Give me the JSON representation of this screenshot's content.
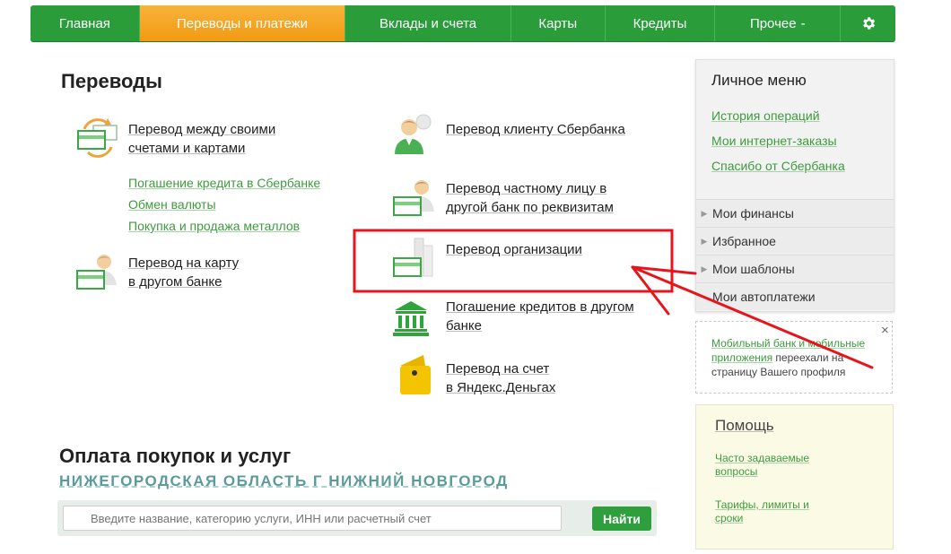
{
  "nav": {
    "items": [
      {
        "label": "Главная"
      },
      {
        "label": "Переводы и платежи"
      },
      {
        "label": "Вклады и счета"
      },
      {
        "label": "Карты"
      },
      {
        "label": "Кредиты"
      },
      {
        "label": "Прочее"
      }
    ],
    "more_caret": "-",
    "settings_icon": "gear-icon",
    "active_color": "#f5a623",
    "bar_color": "#2a9c3a"
  },
  "transfers": {
    "title": "Переводы",
    "own_accounts": "Перевод между своими счетами и картами",
    "own_accounts_l1": "Перевод между своими",
    "own_accounts_l2": "счетами и картами",
    "sub_links": [
      "Погашение кредита в Сбербанке",
      "Обмен валюты",
      "Покупка и продажа металлов"
    ],
    "card_other_l1": "Перевод на карту",
    "card_other_l2": "в другом банке",
    "client_sber": "Перевод клиенту Сбербанка",
    "private_l1": "Перевод частному лицу в",
    "private_l2": "другой банк по реквизитам",
    "organization": "Перевод организации",
    "loan_l1": "Погашение кредитов в другом",
    "loan_l2": "банке",
    "yandex_l1": "Перевод на счет",
    "yandex_l2": "в Яндекс.Деньгах"
  },
  "payments": {
    "title": "Оплата покупок и услуг",
    "region": "НИЖЕГОРОДСКАЯ ОБЛАСТЬ Г НИЖНИЙ НОВГОРОД",
    "search_placeholder": "Введите название, категорию услуги, ИНН или расчетный счет",
    "search_button": "Найти"
  },
  "sidebar": {
    "title": "Личное меню",
    "links": [
      "История операций",
      "Мои интернет-заказы",
      "Спасибо от Сбербанка"
    ],
    "items": [
      "Мои финансы",
      "Избранное",
      "Мои шаблоны",
      "Мои автоплатежи"
    ]
  },
  "notice": {
    "link1": "Мобильный банк и мобильные",
    "link2": "приложения",
    "text1": " переехали на",
    "text2": "страницу Вашего профиля",
    "close": "×"
  },
  "help": {
    "title": "Помощь",
    "faq_l1": "Часто задаваемые",
    "faq_l2": "вопросы",
    "tariffs_l1": "Тарифы, лимиты и",
    "tariffs_l2": "сроки"
  },
  "annotation_color": "#e8141c"
}
